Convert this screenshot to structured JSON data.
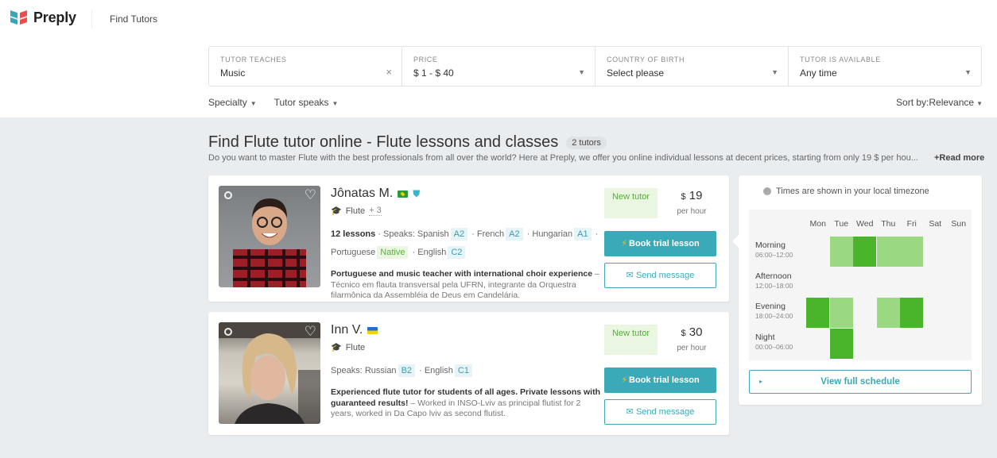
{
  "header": {
    "brand": "Preply",
    "nav_link": "Find Tutors",
    "brand_colors": {
      "teal": "#3aa6b9",
      "red": "#ef4b4b"
    }
  },
  "filters": [
    {
      "label": "TUTOR TEACHES",
      "value": "Music",
      "icon": "clear-icon"
    },
    {
      "label": "PRICE",
      "value": "$ 1 - $ 40",
      "icon": "caret-down-icon"
    },
    {
      "label": "COUNTRY OF BIRTH",
      "value": "Select please",
      "icon": "caret-down-icon"
    },
    {
      "label": "TUTOR IS AVAILABLE",
      "value": "Any time",
      "icon": "caret-down-icon"
    }
  ],
  "subfilters": {
    "specialty": "Specialty",
    "tutor_speaks": "Tutor speaks",
    "sort": "Sort by:Relevance"
  },
  "results": {
    "title": "Find Flute tutor online - Flute lessons and classes",
    "count": "2 tutors",
    "description": "Do you want to master Flute with the best professionals from all over the world? Here at Preply, we offer you online individual lessons at decent prices, starting from only 19 $ per hou...",
    "read_more": "+Read more"
  },
  "tutors": [
    {
      "name": "Jônatas M.",
      "flag": "Brazil",
      "verified": true,
      "subject": "Flute",
      "subject_extra": "+ 3",
      "lessons": "12 lessons",
      "speaks_label": "Speaks:",
      "languages": [
        {
          "name": "Spanish",
          "level": "A2"
        },
        {
          "name": "French",
          "level": "A2"
        },
        {
          "name": "Hungarian",
          "level": "A1"
        },
        {
          "name": "Portuguese",
          "level": "Native"
        },
        {
          "name": "English",
          "level": "C2"
        }
      ],
      "bio_title": "Portuguese and music teacher with international choir experience",
      "bio_text": "Técnico em flauta transversal pela UFRN, integrante da Orquestra filarmônica da Assembléia de Deus em Candelária.",
      "badge": "New tutor",
      "currency": "$",
      "price": "19",
      "per": "per hour",
      "book_label": "Book trial lesson",
      "message_label": "Send message"
    },
    {
      "name": "Inn V.",
      "flag": "Ukraine",
      "verified": false,
      "subject": "Flute",
      "subject_extra": "",
      "lessons": "",
      "speaks_label": "Speaks:",
      "languages": [
        {
          "name": "Russian",
          "level": "B2"
        },
        {
          "name": "English",
          "level": "C1"
        }
      ],
      "bio_title": "Experienced flute tutor for students of all ages. Private lessons with guaranteed results!",
      "bio_text": "Worked in INSO-Lviv as principal flutist for 2 years, worked in Da Capo lviv as second flutist.",
      "badge": "New tutor",
      "currency": "$",
      "price": "30",
      "per": "per hour",
      "book_label": "Book trial lesson",
      "message_label": "Send message"
    }
  ],
  "schedule": {
    "timezone_note": "Times are shown in your local timezone",
    "days": [
      "Mon",
      "Tue",
      "Wed",
      "Thu",
      "Fri",
      "Sat",
      "Sun"
    ],
    "slots": [
      {
        "name": "Morning",
        "range": "06:00–12:00",
        "availability": [
          0,
          1,
          2,
          1,
          1,
          0,
          0
        ]
      },
      {
        "name": "Afternoon",
        "range": "12:00–18:00",
        "availability": [
          0,
          0,
          0,
          0,
          0,
          0,
          0
        ]
      },
      {
        "name": "Evening",
        "range": "18:00–24:00",
        "availability": [
          2,
          1,
          0,
          1,
          2,
          0,
          0
        ]
      },
      {
        "name": "Night",
        "range": "00:00–06:00",
        "availability": [
          0,
          2,
          0,
          0,
          0,
          0,
          0
        ]
      }
    ],
    "legend": {
      "0": "none",
      "1": "some",
      "2": "high"
    },
    "colors": {
      "some": "#9bd882",
      "high": "#4ab42a"
    },
    "view_label": "View full schedule"
  }
}
